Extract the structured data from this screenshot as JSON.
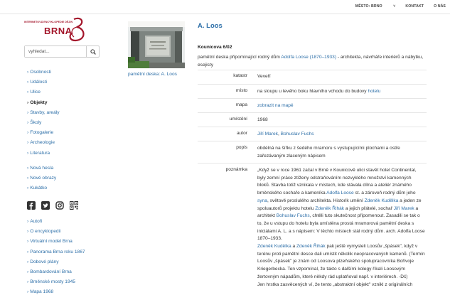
{
  "topnav": {
    "city": "MĚSTO: BRNO",
    "city_caret": "˅",
    "contact": "KONTAKT",
    "about": "O NÁS"
  },
  "logo": {
    "small_text": "INTERNETOVÁ ENCYKLOPEDIE DĚJIN",
    "big_text": "BRNA"
  },
  "search": {
    "placeholder": "vyhledat...",
    "icon": "search-icon"
  },
  "nav_primary": [
    {
      "label": "Osobnosti",
      "active": false
    },
    {
      "label": "Události",
      "active": false
    },
    {
      "label": "Ulice",
      "active": false
    },
    {
      "label": "Objekty",
      "active": true
    },
    {
      "label": "Stavby, areály",
      "active": false
    },
    {
      "label": "Školy",
      "active": false
    },
    {
      "label": "Fotogalerie",
      "active": false
    },
    {
      "label": "Archeologie",
      "active": false
    },
    {
      "label": "Literatura",
      "active": false
    }
  ],
  "nav_secondary": [
    {
      "label": "Nová hesla"
    },
    {
      "label": "Nové obrazy"
    },
    {
      "label": "Kukátko"
    }
  ],
  "socials": [
    "facebook-icon",
    "twitter-icon",
    "instagram-icon",
    "qr-code-icon"
  ],
  "nav_tertiary": [
    {
      "label": "Autoři"
    },
    {
      "label": "O encyklopedii"
    },
    {
      "label": "Virtuální model Brna"
    },
    {
      "label": "Panorama Brna roku 1867"
    },
    {
      "label": "Dobové plány"
    },
    {
      "label": "Bombardování Brna"
    },
    {
      "label": "Brněnské mosty 1945"
    },
    {
      "label": "Mapa 1968"
    }
  ],
  "photo": {
    "caption": "pamětní deska: A. Loos"
  },
  "entry": {
    "title": "A. Loos",
    "address": "Kounicova 6/02",
    "desc_pre": "pamětní deska připomínající rodný dům ",
    "desc_link": "Adolfa Loose (1870–1933)",
    "desc_post": " - architekta, návrháře interiérů a nábytku, esejisty",
    "rows": {
      "katastr": {
        "label": "katastr",
        "value": "Veveří"
      },
      "misto": {
        "label": "místo",
        "value_pre": "na sloupu u levého boku hlavního vchodu do budovy ",
        "value_link": "hotelu"
      },
      "mapa": {
        "label": "mapa",
        "value_link": "zobrazit na mapě"
      },
      "umisteni": {
        "label": "umístění",
        "value": "1968"
      },
      "autor": {
        "label": "autor",
        "link1": "Jiří Marek",
        "sep": ", ",
        "link2": "Bohuslav Fuchs"
      },
      "popis": {
        "label": "popis",
        "value": "obdélná na šířku z šedého mramoru s vystupujícími plochami a ostře zařezávaným zlaceným nápisem"
      },
      "poznamka": {
        "label": "poznámka",
        "t1": "„Když se v roce 1961 začal v Brně v Kounicově ulici stavět hotel Continental, byly zemní práce ztíženy odstraňováním nezvyklého množství kamenných bloků. Stavba totiž vznikala v místech, kde stávala dílna a ateliér známého brněnského sochaře a kameníka ",
        "l1": "Adolfa Loose",
        "t2": " st. a zároveň rodný dům jeho ",
        "l2": "syna",
        "t3": ", světově proslulého architekta. Historik umění ",
        "l3": "Zdeněk Kudělka",
        "t4": " a jeden ze spoluautorů projektu hotelu ",
        "l4": "Zdeněk Řihák",
        "t5": " a jejich přátelé, sochař ",
        "l5": "Jiří Marek",
        "t6": " a architekt ",
        "l6": "Bohuslav Fuchs",
        "t7": ", chtěli tuto skutečnost připomenout. Zasadili se tak o to, že u vstupu do hotelu byla umístěna prostá mramorová pamětní deska s iniciálami A. L. a s nápisem: V těchto místech stál rodný dům. arch. Adolfa Loose 1870–1933.",
        "l7": "Zdeněk Kudělka",
        "t8": " a ",
        "l8": "Zdeněk Řihák",
        "t9": " pak ještě vymysleli Loosův „špásek\", když v terénu proti pamětní desce dali umístit několik neopracovaných kamenů. (Termín Loosův „špásek\" je znám od Loosova plzeňského spolupracovníka Bořivoje Kriegerbecka. Ten vzpomínal, že takto s dalšími kolegy říkali Loosovým žertovným nápadům, které někdy rád uplatňoval např. v interiérech. -Dč)",
        "t10": "Jen hrstka zasvěcených ví, že tento „abstraktní objekt\" vznikl z originálních"
      }
    }
  }
}
